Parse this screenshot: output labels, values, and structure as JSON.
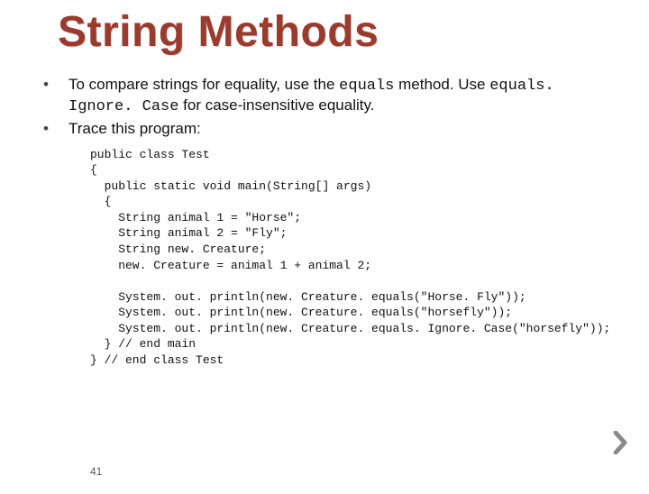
{
  "title": "String Methods",
  "bullets": [
    {
      "prefix": "To compare strings for equality, use the ",
      "code1": "equals",
      "mid": " method. Use ",
      "code2": "equals. Ignore. Case",
      "suffix": " for case-insensitive equality."
    },
    {
      "text": "Trace this program:"
    }
  ],
  "code": "public class Test\n{\n  public static void main(String[] args)\n  {\n    String animal 1 = \"Horse\";\n    String animal 2 = \"Fly\";\n    String new. Creature;\n    new. Creature = animal 1 + animal 2;\n\n    System. out. println(new. Creature. equals(\"Horse. Fly\"));\n    System. out. println(new. Creature. equals(\"horsefly\"));\n    System. out. println(new. Creature. equals. Ignore. Case(\"horsefly\"));\n  } // end main\n} // end class Test",
  "page_number": "41"
}
